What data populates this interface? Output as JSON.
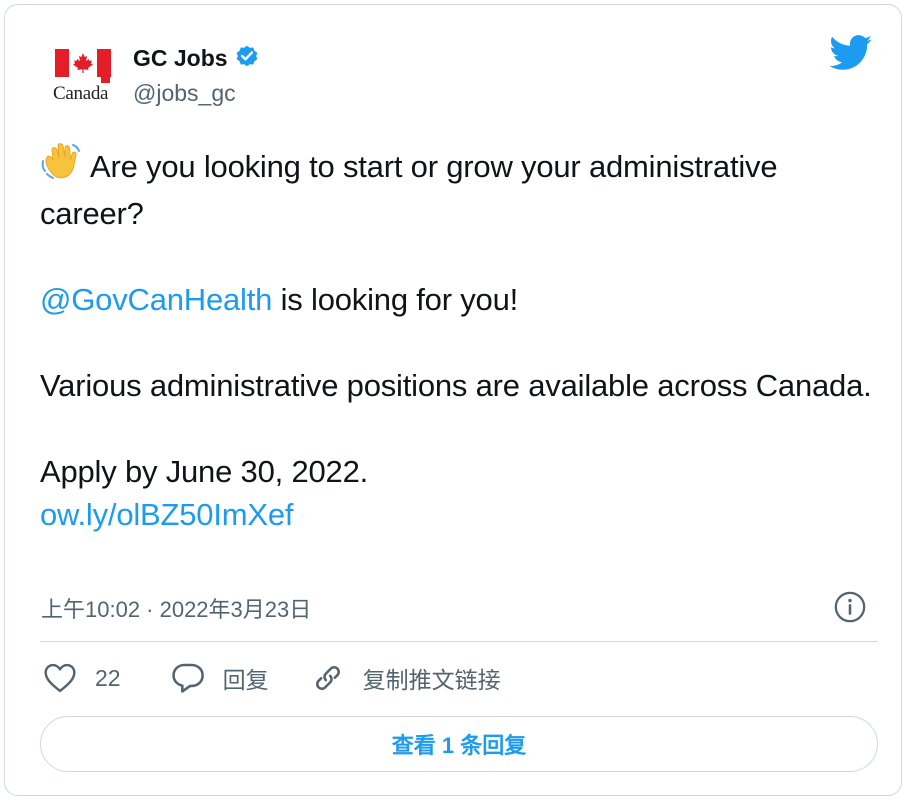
{
  "author": {
    "display_name": "GC Jobs",
    "handle": "@jobs_gc",
    "verified": true,
    "avatar_text": "Canada"
  },
  "tweet": {
    "line1": "Are you looking to start or grow your administrative career?",
    "mention": "@GovCanHealth",
    "line2_rest": " is looking for you!",
    "line3": "Various administrative positions are available across Canada.",
    "line4": "Apply by June 30, 2022.",
    "link": "ow.ly/olBZ50ImXef",
    "emoji": "waving-hand"
  },
  "meta": {
    "timestamp": "上午10:02 · 2022年3月23日"
  },
  "actions": {
    "like_count": "22",
    "reply_label": "回复",
    "copy_link_label": "复制推文链接"
  },
  "footer": {
    "view_replies_label": "查看 1 条回复"
  },
  "colors": {
    "accent": "#1d9bf0",
    "text": "#0f1419",
    "muted": "#536471",
    "border": "#cfd9de",
    "flag_red": "#e41d26"
  }
}
